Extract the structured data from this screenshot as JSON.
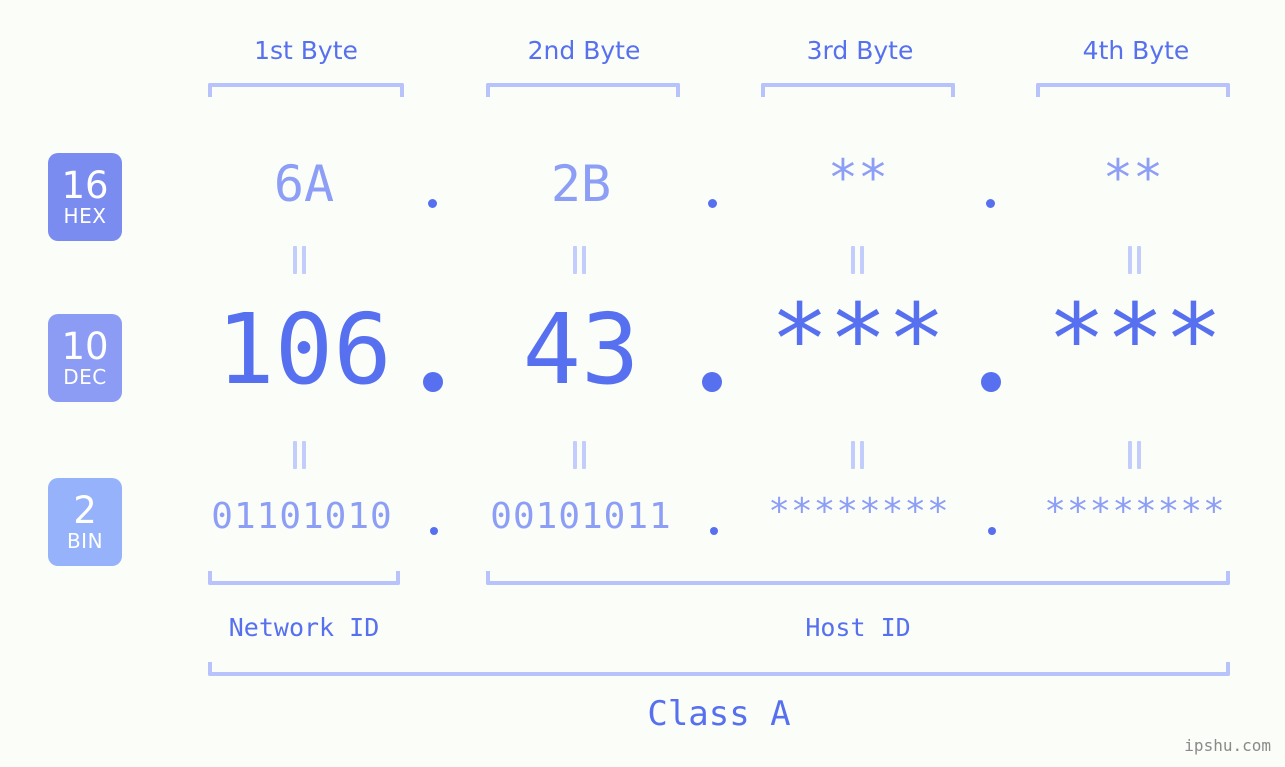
{
  "theme": {
    "background": "#fbfdf8",
    "accent": "#5770ef",
    "accent_light": "#8d9ef6",
    "bracket": "#b8c3fb",
    "eq_mark": "#c3cdfc",
    "badge_hex": "#7b8cf0",
    "badge_dec": "#8c9cf5",
    "badge_bin": "#96b2fa",
    "watermark": "#8a8a8a"
  },
  "byte_headers": [
    {
      "label": "1st Byte"
    },
    {
      "label": "2nd Byte"
    },
    {
      "label": "3rd Byte"
    },
    {
      "label": "4th Byte"
    }
  ],
  "radix_badges": [
    {
      "number": "16",
      "abbr": "HEX"
    },
    {
      "number": "10",
      "abbr": "DEC"
    },
    {
      "number": "2",
      "abbr": "BIN"
    }
  ],
  "rows": {
    "hex": {
      "radix": "16",
      "name": "HEX",
      "values": [
        "6A",
        "2B",
        "**",
        "**"
      ],
      "separator": "."
    },
    "dec": {
      "radix": "10",
      "name": "DEC",
      "values": [
        "106",
        "43",
        "***",
        "***"
      ],
      "separator": "."
    },
    "bin": {
      "radix": "2",
      "name": "BIN",
      "values": [
        "01101010",
        "00101011",
        "********",
        "********"
      ],
      "separator": "."
    }
  },
  "equivalence_mark": "||",
  "sections": {
    "network_id": "Network ID",
    "host_id": "Host ID",
    "class": "Class A"
  },
  "watermark": "ipshu.com"
}
